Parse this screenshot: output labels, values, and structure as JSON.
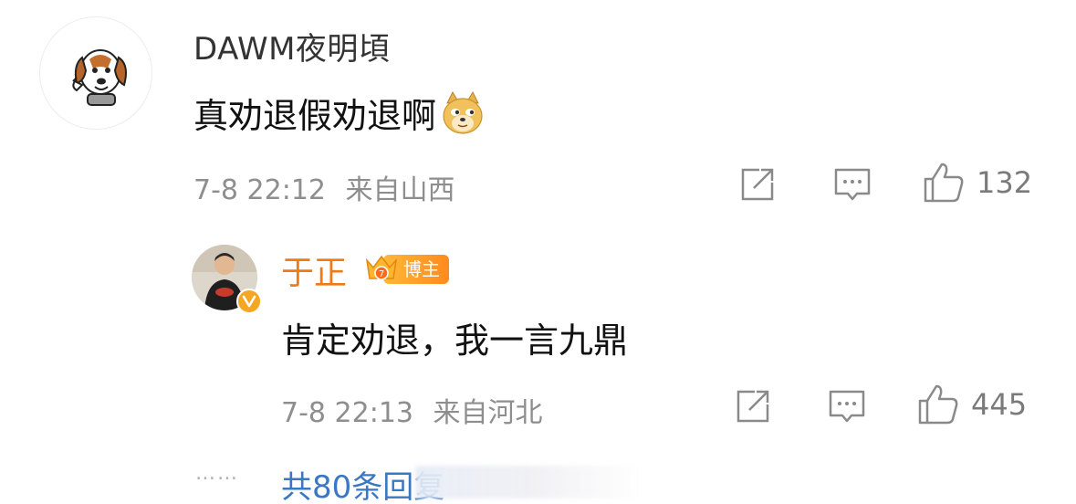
{
  "comment": {
    "username": "DAWM夜明頃",
    "text": "真劝退假劝退啊",
    "emoji": "doge-emoji",
    "time": "7-8 22:12",
    "location": "来自山西",
    "likes": "132"
  },
  "reply": {
    "username": "于正",
    "badge_label": "博主",
    "text": "肯定劝退，我一言九鼎",
    "time": "7-8 22:13",
    "location": "来自河北",
    "likes": "445"
  },
  "footer": {
    "dots": "……",
    "more_replies": "共80条回复"
  },
  "colors": {
    "reply_username": "#f07a14",
    "link_blue": "#3a78c3",
    "meta_gray": "#8e8e8e"
  }
}
